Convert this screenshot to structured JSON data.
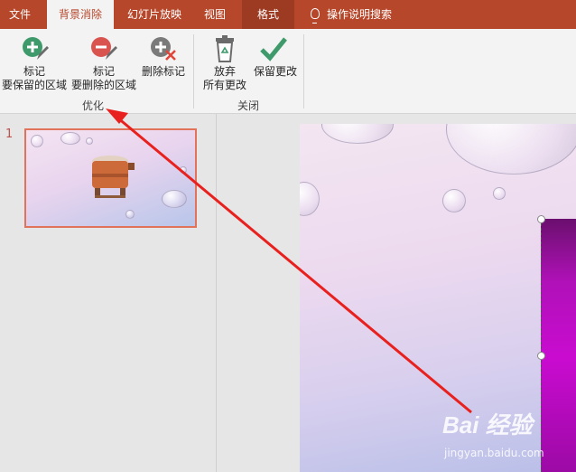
{
  "tabs": [
    {
      "label": "文件"
    },
    {
      "label": "背景消除"
    },
    {
      "label": "幻灯片放映"
    },
    {
      "label": "视图"
    },
    {
      "label": "格式"
    }
  ],
  "search": {
    "label": "操作说明搜索"
  },
  "ribbon": {
    "mark_keep": {
      "line1": "标记",
      "line2": "要保留的区域"
    },
    "mark_remove": {
      "line1": "标记",
      "line2": "要删除的区域"
    },
    "delete_mark": {
      "label": "删除标记"
    },
    "discard": {
      "line1": "放弃",
      "line2": "所有更改"
    },
    "keep_changes": {
      "label": "保留更改"
    },
    "group_refine": "优化",
    "group_close": "关闭"
  },
  "slides_panel": {
    "slide_number": "1"
  },
  "watermark": {
    "brand": "Bai 经验",
    "url": "jingyan.baidu.com"
  },
  "colors": {
    "accent": "#b7472a",
    "annotation_arrow": "#e8201e"
  }
}
